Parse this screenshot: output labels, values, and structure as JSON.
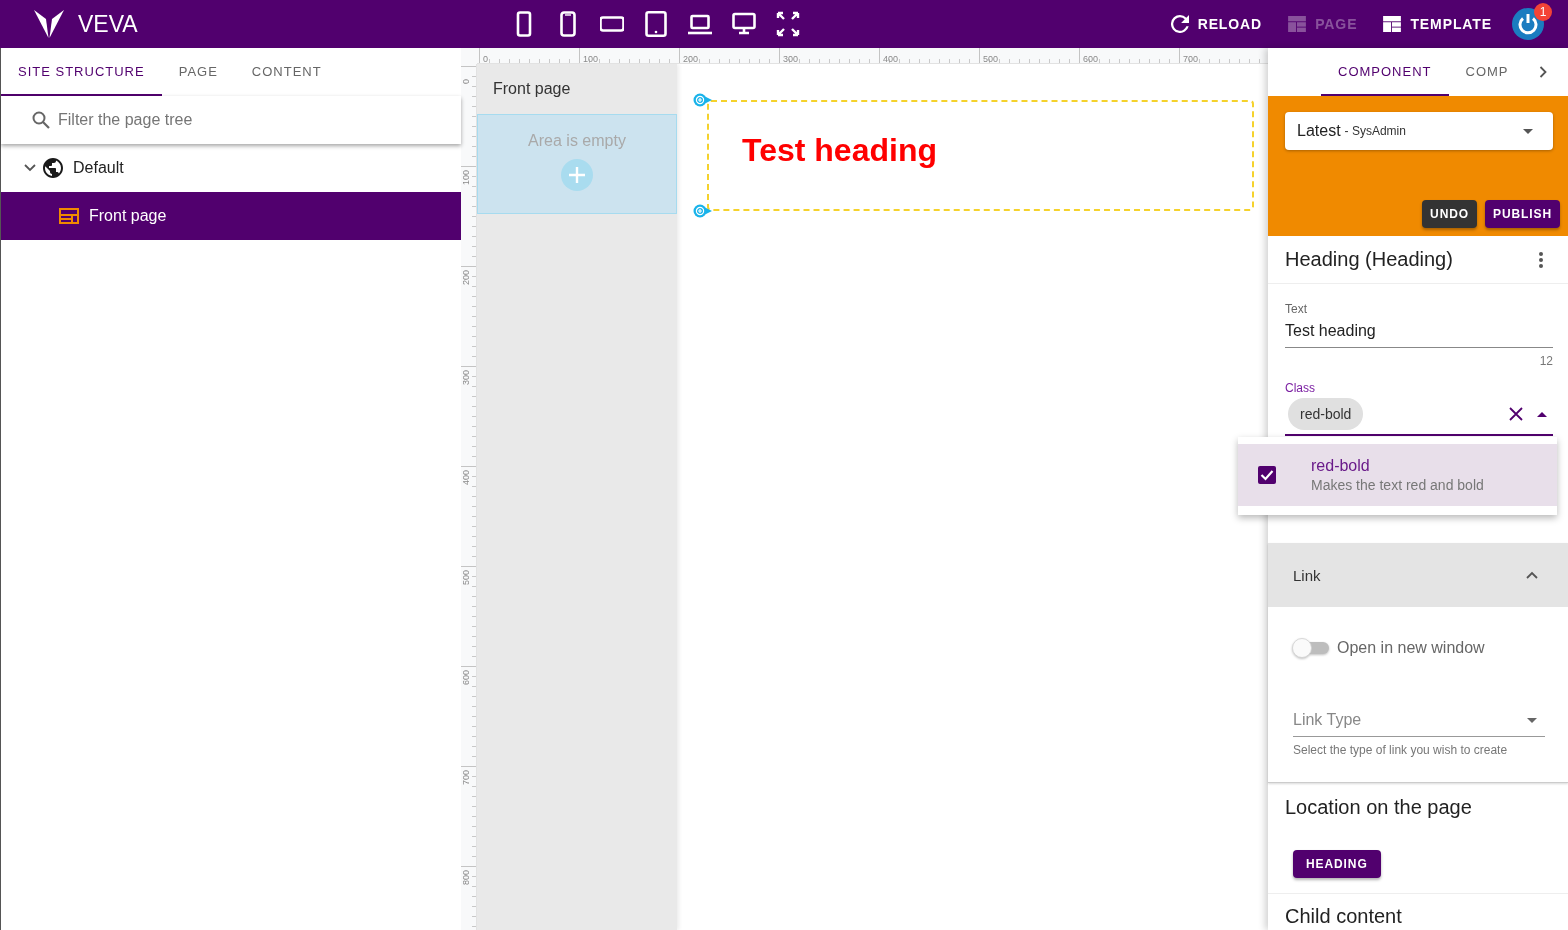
{
  "top_bar": {
    "logo_text": "VEVA",
    "actions": [
      {
        "kind": "reload",
        "label": "RELOAD",
        "disabled": false
      },
      {
        "kind": "page",
        "label": "PAGE",
        "disabled": true
      },
      {
        "kind": "template",
        "label": "TEMPLATE",
        "disabled": false
      }
    ],
    "notification_count": "1"
  },
  "left_panel": {
    "tabs": [
      {
        "label": "SITE STRUCTURE",
        "selected": true
      },
      {
        "label": "PAGE",
        "selected": false
      },
      {
        "label": "CONTENT",
        "selected": false
      }
    ],
    "search": {
      "placeholder": "Filter the page tree"
    },
    "tree": [
      {
        "kind": "site",
        "label": "Default",
        "expanded": true,
        "selected": false,
        "children": [
          {
            "kind": "page",
            "label": "Front page",
            "selected": true
          }
        ]
      }
    ]
  },
  "rulers": {
    "horizontal": [
      "0",
      "100",
      "200",
      "300",
      "400",
      "500",
      "600",
      "700"
    ],
    "vertical": [
      "0",
      "100",
      "200",
      "300",
      "400",
      "500",
      "600",
      "700",
      "800"
    ]
  },
  "canvas": {
    "area": {
      "title": "Front page",
      "empty_text": "Area is empty"
    },
    "heading": {
      "text": "Test heading"
    }
  },
  "right_panel": {
    "tabs": [
      {
        "label": "COMPONENT",
        "selected": true
      },
      {
        "label": "COMP",
        "selected": false
      }
    ],
    "version_select": {
      "value": "Latest",
      "detail": "- SysAdmin"
    },
    "buttons": [
      {
        "kind": "undo",
        "label": "UNDO"
      },
      {
        "kind": "publish",
        "label": "PUBLISH"
      }
    ],
    "component_title": "Heading (Heading)",
    "fields": [
      {
        "kind": "text",
        "label": "Text",
        "value": "Test heading",
        "counter": "12",
        "focused": false
      },
      {
        "kind": "chips",
        "label": "Class",
        "chips": [
          "red-bold"
        ],
        "focused": true,
        "menu": {
          "options": [
            {
              "label": "red-bold",
              "description": "Makes the text red and bold",
              "checked": true,
              "selected": true
            }
          ]
        }
      }
    ],
    "link_section": {
      "title": "Link",
      "expanded": true,
      "toggle": {
        "label": "Open in new window",
        "on": false
      },
      "link_type": {
        "placeholder": "Link Type",
        "hint": "Select the type of link you wish to create"
      }
    },
    "location": {
      "title": "Location on the page",
      "button": "HEADING"
    },
    "child_content": {
      "title": "Child content"
    }
  }
}
